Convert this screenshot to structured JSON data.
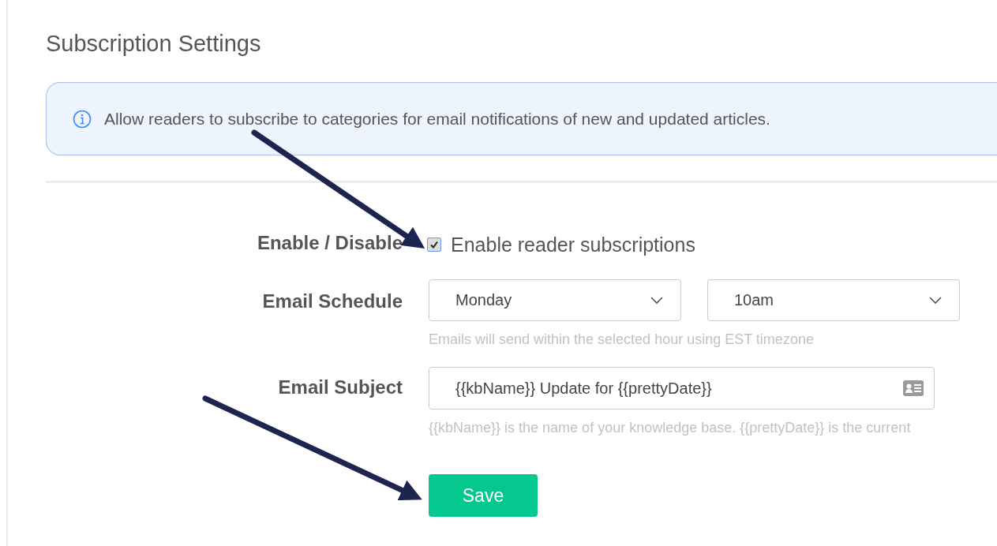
{
  "title": "Subscription Settings",
  "info": {
    "text": "Allow readers to subscribe to categories for email notifications of new and updated articles."
  },
  "form": {
    "enable": {
      "label": "Enable / Disable",
      "option": "Enable reader subscriptions",
      "checked": true
    },
    "schedule": {
      "label": "Email Schedule",
      "day": "Monday",
      "hour": "10am",
      "help": "Emails will send within the selected hour using EST timezone"
    },
    "subject": {
      "label": "Email Subject",
      "value": "{{kbName}} Update for {{prettyDate}}",
      "help": "{{kbName}} is the name of your knowledge base. {{prettyDate}} is the current"
    }
  },
  "save": {
    "label": "Save"
  }
}
